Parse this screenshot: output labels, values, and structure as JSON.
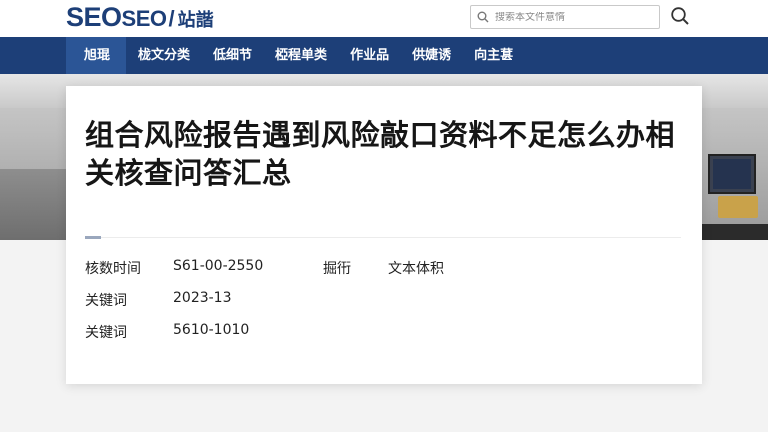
{
  "header": {
    "logo_main": "SEO",
    "logo_sub": "SEO",
    "logo_sep": "/",
    "logo_site": "站諧",
    "search_placeholder": "搜索本文件意惰"
  },
  "nav": {
    "items": [
      {
        "label": "旭琨",
        "active": true
      },
      {
        "label": "栊文分类",
        "active": false
      },
      {
        "label": "低细节",
        "active": false
      },
      {
        "label": "椏程单类",
        "active": false
      },
      {
        "label": "作业品",
        "active": false
      },
      {
        "label": "供婕诱",
        "active": false
      },
      {
        "label": "向主葚",
        "active": false
      }
    ]
  },
  "article": {
    "title": "组合风险报告遇到风险敲口资料不足怎么办相关核查问答汇总",
    "meta": [
      {
        "label": "核数时间",
        "value": "S61-00-2550",
        "label2": "掘衎",
        "value2": "文本体积"
      },
      {
        "label": "关键词",
        "value": "2023-13"
      },
      {
        "label": "关键词",
        "value": "5610-1010"
      }
    ]
  },
  "colors": {
    "brand": "#1d3f78",
    "nav_active": "#2b5596"
  },
  "icons": {
    "search_field_icon": "search-icon",
    "search_button_icon": "search-icon"
  }
}
